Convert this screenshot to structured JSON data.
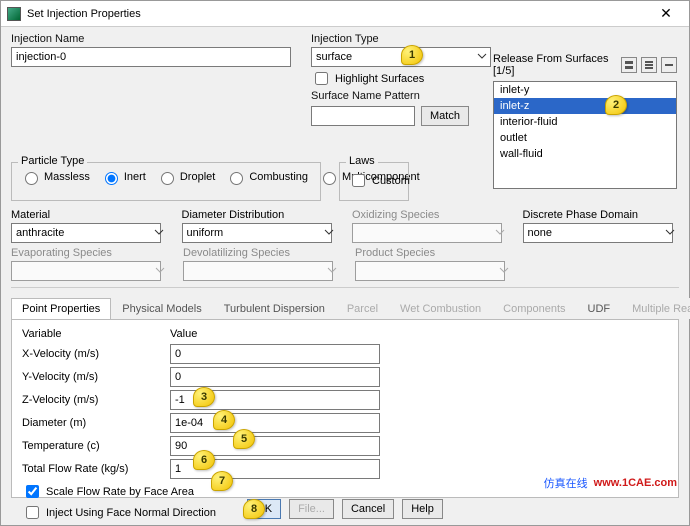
{
  "window": {
    "title": "Set Injection Properties"
  },
  "injection": {
    "name_label": "Injection Name",
    "name_value": "injection-0",
    "type_label": "Injection Type",
    "type_value": "surface",
    "highlight_label": "Highlight Surfaces",
    "surface_pattern_label": "Surface Name Pattern",
    "match_btn": "Match"
  },
  "release": {
    "header": "Release From Surfaces [1/5]",
    "items": [
      "inlet-y",
      "inlet-z",
      "interior-fluid",
      "outlet",
      "wall-fluid"
    ],
    "selected": "inlet-z"
  },
  "particle_type": {
    "legend": "Particle Type",
    "options": [
      "Massless",
      "Inert",
      "Droplet",
      "Combusting",
      "Multicomponent"
    ]
  },
  "laws": {
    "legend": "Laws",
    "custom": "Custom"
  },
  "material": {
    "label": "Material",
    "value": "anthracite"
  },
  "diam_dist": {
    "label": "Diameter Distribution",
    "value": "uniform"
  },
  "oxid": {
    "label": "Oxidizing Species"
  },
  "dpd": {
    "label": "Discrete Phase Domain",
    "value": "none"
  },
  "evap": {
    "label": "Evaporating Species"
  },
  "devol": {
    "label": "Devolatilizing Species"
  },
  "prod": {
    "label": "Product Species"
  },
  "tabs": {
    "point": "Point Properties",
    "phys": "Physical Models",
    "turb": "Turbulent Dispersion",
    "parcel": "Parcel",
    "wet": "Wet Combustion",
    "comp": "Components",
    "udf": "UDF",
    "multi": "Multiple Reactions"
  },
  "props": {
    "var_hdr": "Variable",
    "val_hdr": "Value",
    "xvel_label": "X-Velocity (m/s)",
    "xvel_value": "0",
    "yvel_label": "Y-Velocity (m/s)",
    "yvel_value": "0",
    "zvel_label": "Z-Velocity (m/s)",
    "zvel_value": "-1",
    "diam_label": "Diameter (m)",
    "diam_value": "1e-04",
    "temp_label": "Temperature (c)",
    "temp_value": "90",
    "flow_label": "Total Flow Rate (kg/s)",
    "flow_value": "1",
    "scale_label": "Scale Flow Rate by Face Area",
    "inject_label": "Inject Using Face Normal Direction"
  },
  "buttons": {
    "ok": "OK",
    "file": "File...",
    "cancel": "Cancel",
    "help": "Help"
  },
  "watermark": {
    "cn": "仿真在线",
    "en": "www.1CAE.com"
  },
  "markers": [
    "1",
    "2",
    "3",
    "4",
    "5",
    "6",
    "7",
    "8"
  ]
}
